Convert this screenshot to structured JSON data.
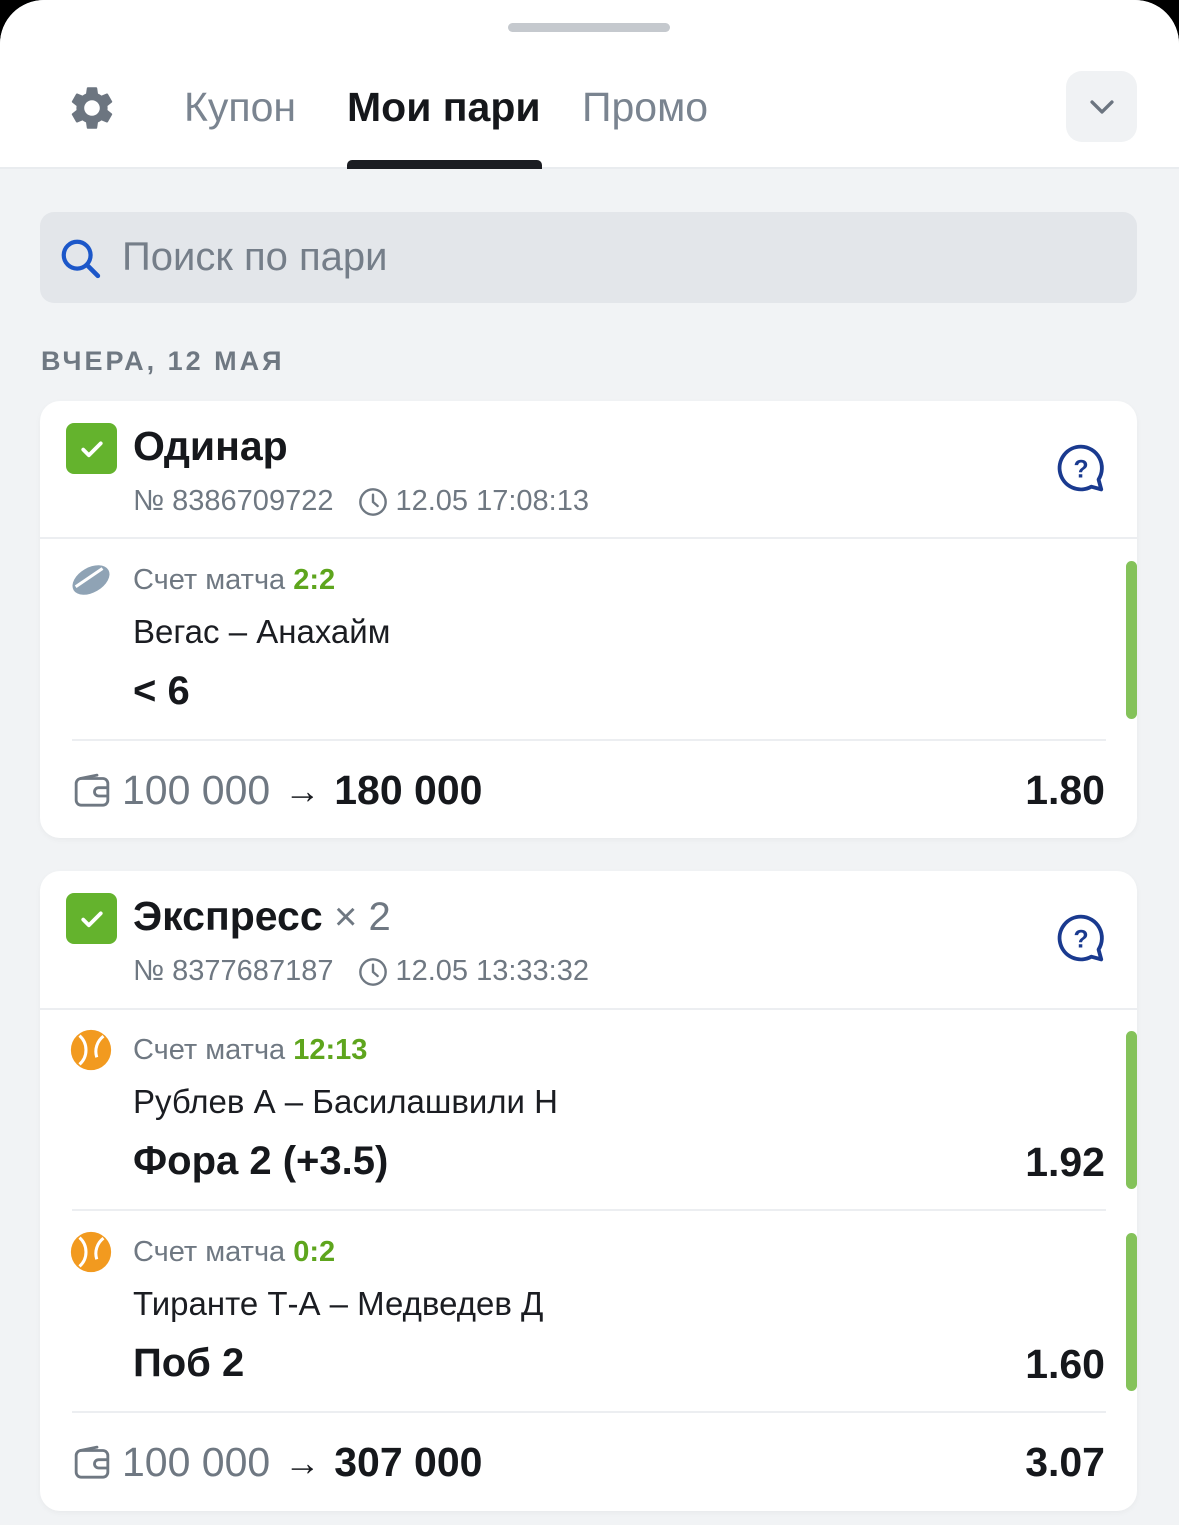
{
  "header": {
    "tabs": [
      {
        "label": "Купон",
        "active": false
      },
      {
        "label": "Мои пари",
        "active": true
      },
      {
        "label": "Промо",
        "active": false
      }
    ]
  },
  "search": {
    "placeholder": "Поиск по пари"
  },
  "date_group": "ВЧЕРА, 12 МАЯ",
  "bets": [
    {
      "type": "Одинар",
      "number": "№ 8386709722",
      "datetime": "12.05 17:08:13",
      "events": [
        {
          "sport_icon": "hockey-puck-icon",
          "score_label": "Счет матча",
          "score": "2:2",
          "teams": "Вегас – Анахайм",
          "outcome": "< 6"
        }
      ],
      "stake": "100 000",
      "payout": "180 000",
      "total_odd": "1.80"
    },
    {
      "type": "Экспресс",
      "multiplier": "× 2",
      "number": "№ 8377687187",
      "datetime": "12.05 13:33:32",
      "events": [
        {
          "sport_icon": "tennis-ball-icon",
          "score_label": "Счет матча",
          "score": "12:13",
          "teams": "Рублев А – Басилашвили Н",
          "outcome": "Фора 2 (+3.5)",
          "odd": "1.92"
        },
        {
          "sport_icon": "tennis-ball-icon",
          "score_label": "Счет матча",
          "score": "0:2",
          "teams": "Тиранте Т-А – Медведев Д",
          "outcome": "Поб 2",
          "odd": "1.60"
        }
      ],
      "stake": "100 000",
      "payout": "307 000",
      "total_odd": "3.07"
    }
  ],
  "colors": {
    "accent_green": "#64b32d",
    "score_green": "#5ea51d",
    "status_bar": "#84c25a",
    "help_blue": "#1a3a8f",
    "tennis_orange": "#f29a1f"
  }
}
